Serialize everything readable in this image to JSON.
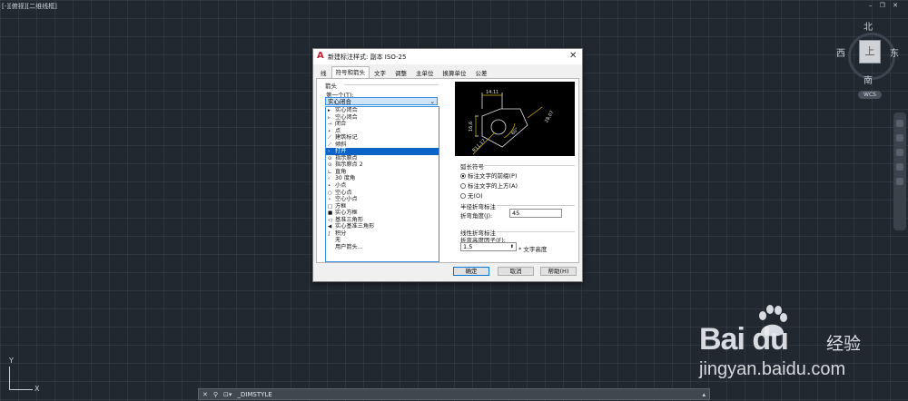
{
  "viewport_label": "[-][俯视][二维线框]",
  "window_controls": "– ❐ ✕",
  "viewcube": {
    "north": "北",
    "south": "南",
    "west": "西",
    "east": "东",
    "face": "上",
    "wcs": "WCS"
  },
  "ucs": {
    "x": "X",
    "y": "Y"
  },
  "command_line": {
    "close": "✕",
    "search": "⚲",
    "prompt": "⊡▾",
    "text": "_DIMSTYLE",
    "menu": "▴"
  },
  "watermark": {
    "logo": "Bai  du",
    "jingyan": "经验",
    "url": "jingyan.baidu.com"
  },
  "dialog": {
    "title": "新建标注样式: 副本 ISO-25",
    "close": "✕",
    "tabs": [
      "线",
      "符号和箭头",
      "文字",
      "调整",
      "主单位",
      "换算单位",
      "公差"
    ],
    "active_tab": 1,
    "arrows_group": "箭头",
    "first_label": "第一个(T):",
    "first_value": "实心闭合",
    "options": [
      "实心闭合",
      "空心闭合",
      "闭合",
      "点",
      "建筑标记",
      "倾斜",
      "打开",
      "指示原点",
      "指示原点 2",
      "直角",
      "30 度角",
      "小点",
      "空心点",
      "空心小点",
      "方框",
      "实心方框",
      "基准三角形",
      "实心基准三角形",
      "积分",
      "无",
      "用户箭头..."
    ],
    "option_glyphs": [
      "▸",
      "▹",
      "⇾",
      "•",
      "⟋",
      "⟋",
      "›",
      "⊙",
      "⊙",
      "∟",
      "‹",
      "•",
      "○",
      "∘",
      "□",
      "■",
      "◁",
      "◀",
      "∫",
      "",
      ""
    ],
    "selected_index": 6,
    "arc_length_group": "弧长符号",
    "arc_options": [
      "标注文字的前缀(P)",
      "标注文字的上方(A)",
      "无(O)"
    ],
    "arc_selected": 0,
    "radius_jog_group": "半径折弯标注",
    "jog_angle_label": "折弯角度(J):",
    "jog_angle_value": "45",
    "linear_jog_group": "线性折弯标注",
    "jog_height_label": "折弯高度因子(F):",
    "jog_height_value": "1.5",
    "jog_height_suffix": "* 文字高度",
    "preview_dims": [
      "14,11",
      "16,6",
      "28,07",
      "R11,17",
      "60°"
    ],
    "buttons": {
      "ok": "确定",
      "cancel": "取消",
      "help": "帮助(H)"
    }
  }
}
